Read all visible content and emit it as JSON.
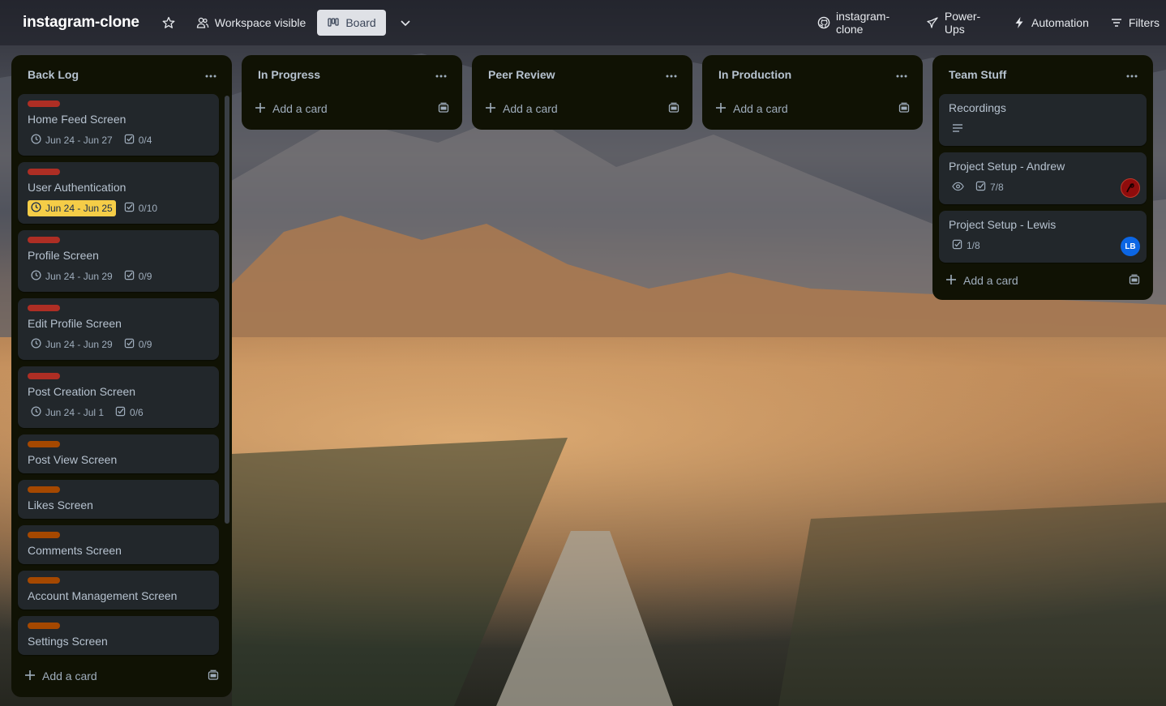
{
  "header": {
    "board_title": "instagram-clone",
    "star_icon": "star-icon",
    "visibility_label": "Workspace visible",
    "view_label": "Board",
    "github_label": "instagram-clone",
    "powerups_label": "Power-Ups",
    "automation_label": "Automation",
    "filter_label": "Filters"
  },
  "lists": [
    {
      "title": "Back Log",
      "cards": [
        {
          "label_color": "#ae2e24",
          "title": "Home Feed Screen",
          "dates": "Jun 24 - Jun 27",
          "checklist": "0/4"
        },
        {
          "label_color": "#ae2e24",
          "title": "User Authentication",
          "dates": "Jun 24 - Jun 25",
          "checklist": "0/10"
        },
        {
          "label_color": "#ae2e24",
          "title": "Profile Screen",
          "dates": "Jun 24 - Jun 29",
          "checklist": "0/9"
        },
        {
          "label_color": "#ae2e24",
          "title": "Edit Profile Screen",
          "dates": "Jun 24 - Jun 29",
          "checklist": "0/9"
        },
        {
          "label_color": "#ae2e24",
          "title": "Post Creation Screen",
          "dates": "Jun 24 - Jul 1",
          "checklist": "0/6"
        },
        {
          "label_color": "#a54800",
          "title": "Post View Screen"
        },
        {
          "label_color": "#a54800",
          "title": "Likes Screen"
        },
        {
          "label_color": "#a54800",
          "title": "Comments Screen"
        },
        {
          "label_color": "#a54800",
          "title": "Account Management Screen"
        },
        {
          "label_color": "#a54800",
          "title": "Settings Screen"
        }
      ],
      "add_label": "Add a card"
    },
    {
      "title": "In Progress",
      "add_label": "Add a card"
    },
    {
      "title": "Peer Review",
      "add_label": "Add a card"
    },
    {
      "title": "In Production",
      "add_label": "Add a card"
    },
    {
      "title": "Team Stuff",
      "cards": [
        {
          "title": "Recordings"
        },
        {
          "title": "Project Setup - Andrew",
          "checklist": "7/8",
          "avatar_color": "#8f0c0c"
        },
        {
          "title": "Project Setup - Lewis",
          "checklist": "1/8",
          "avatar": "LB",
          "avatar_color": "#0c66e4"
        }
      ],
      "add_label": "Add a card"
    }
  ],
  "colors": {
    "list_bg": "#101204",
    "card_bg": "#22272b",
    "red_label": "#ae2e24",
    "orange_label": "#a54800",
    "due_soon": "#f5cd47"
  }
}
